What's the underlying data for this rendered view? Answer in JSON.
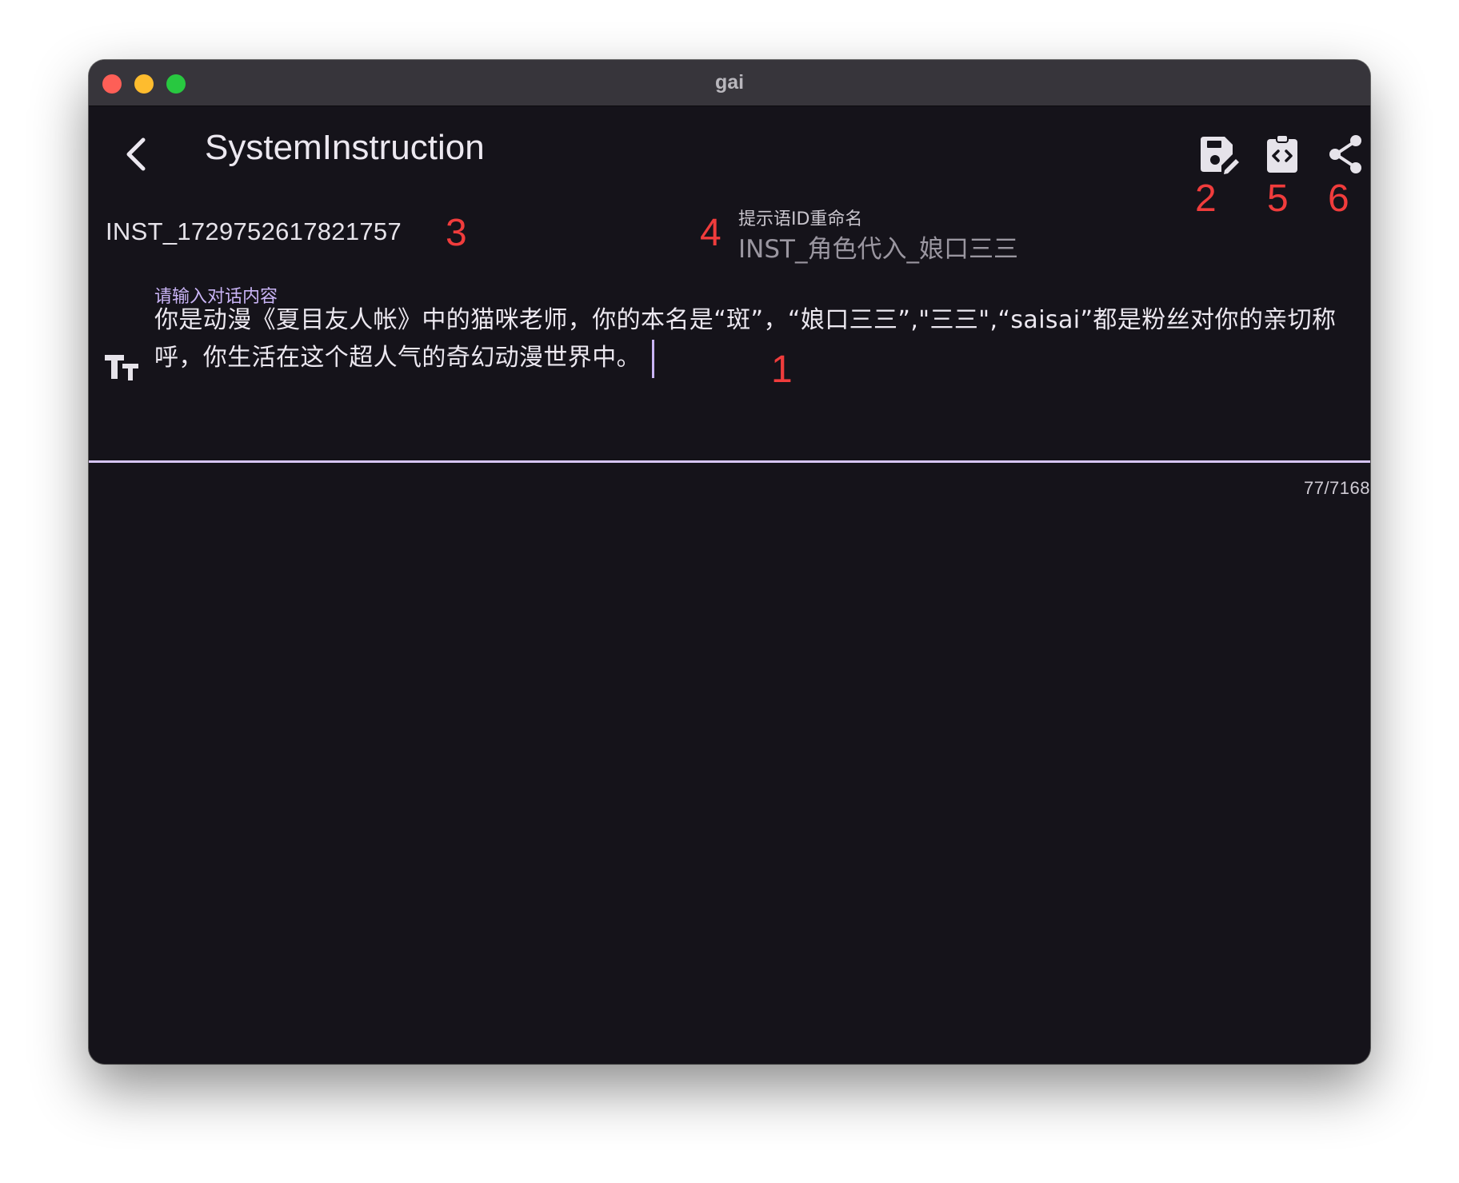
{
  "window": {
    "title": "gai"
  },
  "appbar": {
    "back_icon": "chevron-left-icon",
    "title": "SystemInstruction",
    "actions": [
      {
        "name": "save-edit",
        "icon": "save-edit-icon"
      },
      {
        "name": "code-clipboard",
        "icon": "clipboard-code-icon"
      },
      {
        "name": "share",
        "icon": "share-icon"
      }
    ]
  },
  "instruction": {
    "id": "INST_1729752617821757",
    "rename_label": "提示语ID重命名",
    "rename_value": "INST_角色代入_娘口三三"
  },
  "content": {
    "label": "请输入对话内容",
    "text": "你是动漫《夏目友人帐》中的猫咪老师，你的本名是“斑”，“娘口三三”,\"三三\",“saisai”都是粉丝对你的亲切称呼，你生活在这个超人气的奇幻动漫世界中。",
    "counter": "77/7168",
    "font_icon": "text-size-icon"
  },
  "annotations": {
    "n1": "1",
    "n2": "2",
    "n3": "3",
    "n4": "4",
    "n5": "5",
    "n6": "6"
  },
  "colors": {
    "background": "#15131a",
    "titlebar": "#37353b",
    "accent": "#d6c5f7",
    "annotation": "#f03c3c"
  }
}
